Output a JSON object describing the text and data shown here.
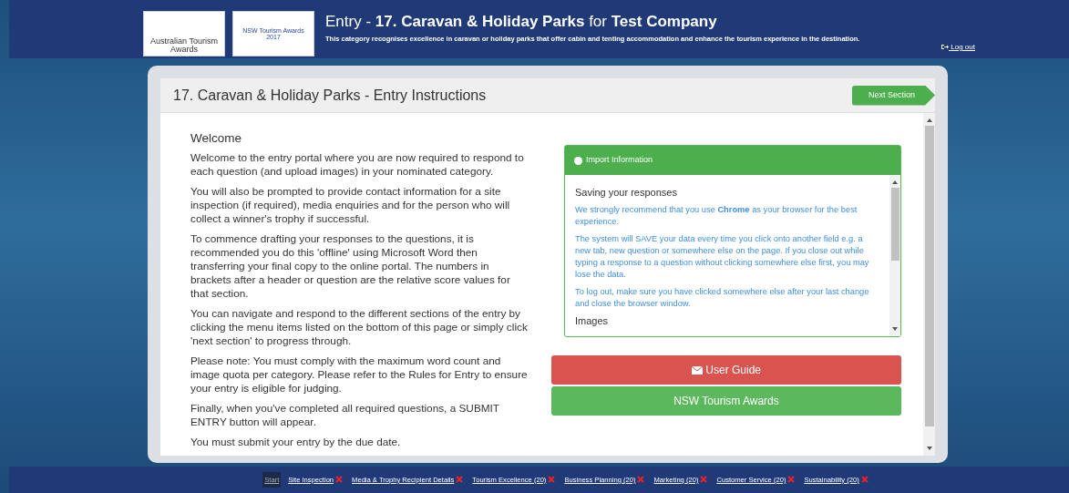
{
  "header": {
    "logos": [
      "Australian Tourism Awards",
      "NSW Tourism Awards 2017"
    ],
    "title_prefix": "Entry - ",
    "title_bold": "17. Caravan & Holiday Parks",
    "title_mid": " for ",
    "title_company": "Test Company",
    "subtitle": "This category recognises excellence in caravan or holiday parks that offer cabin and tenting accommodation and enhance the tourism experience in the destination.",
    "logout": "Log out"
  },
  "card": {
    "title": "17. Caravan & Holiday Parks - Entry Instructions",
    "next_button": "Next Section"
  },
  "welcome": {
    "heading": "Welcome",
    "paragraphs": [
      "Welcome to the entry portal where you are now required to respond to each question (and upload images) in your nominated category.",
      "You will also be prompted to provide contact information for a site inspection (if required), media enquiries and for the person who will collect a winner's trophy if successful.",
      "To commence drafting your responses to the questions, it is recommended you do this 'offline' using Microsoft Word then transferring your final copy to the online portal. The numbers in brackets after a header or question are the relative score values for that section.",
      "You can navigate and respond to the different sections of the entry by clicking the menu items listed on the bottom of this page or simply click 'next section' to progress through.",
      "Please note: You must comply with the maximum word count and image quota per category. Please refer to the Rules for Entry to ensure your entry is eligible for judging.",
      "Finally, when you've completed all required questions, a SUBMIT ENTRY button will appear.",
      "You must submit your entry by the due date."
    ]
  },
  "info_panel": {
    "title": "Import Information",
    "sections": [
      {
        "heading": "Saving your responses",
        "paragraphs": [
          "We strongly recommend that you use **Chrome** as your browser for the best experience.",
          "The system will SAVE your data every time you click onto another field e.g. a new tab, new question or somewhere else on the page. If you close out while typing a response to a question without clicking somewhere else first, you may lose the data.",
          "To log out, make sure you have clicked somewhere else after your last change and close the browser window."
        ]
      },
      {
        "heading": "Images"
      }
    ]
  },
  "buttons": [
    {
      "label": "User Guide",
      "kind": "danger",
      "icon": true
    },
    {
      "label": "NSW Tourism Awards",
      "kind": "success",
      "icon": false
    }
  ],
  "footer_nav": [
    {
      "label": "Start",
      "selected": true,
      "incomplete": false
    },
    {
      "label": "Site Inspection",
      "selected": false,
      "incomplete": true
    },
    {
      "label": "Media & Trophy Recipient Details",
      "selected": false,
      "incomplete": true
    },
    {
      "label": "Tourism Excellence (20)",
      "selected": false,
      "incomplete": true
    },
    {
      "label": "Business Planning (20)",
      "selected": false,
      "incomplete": true
    },
    {
      "label": "Marketing (20)",
      "selected": false,
      "incomplete": true
    },
    {
      "label": "Customer Service (20)",
      "selected": false,
      "incomplete": true
    },
    {
      "label": "Sustainability (20)",
      "selected": false,
      "incomplete": true
    }
  ]
}
